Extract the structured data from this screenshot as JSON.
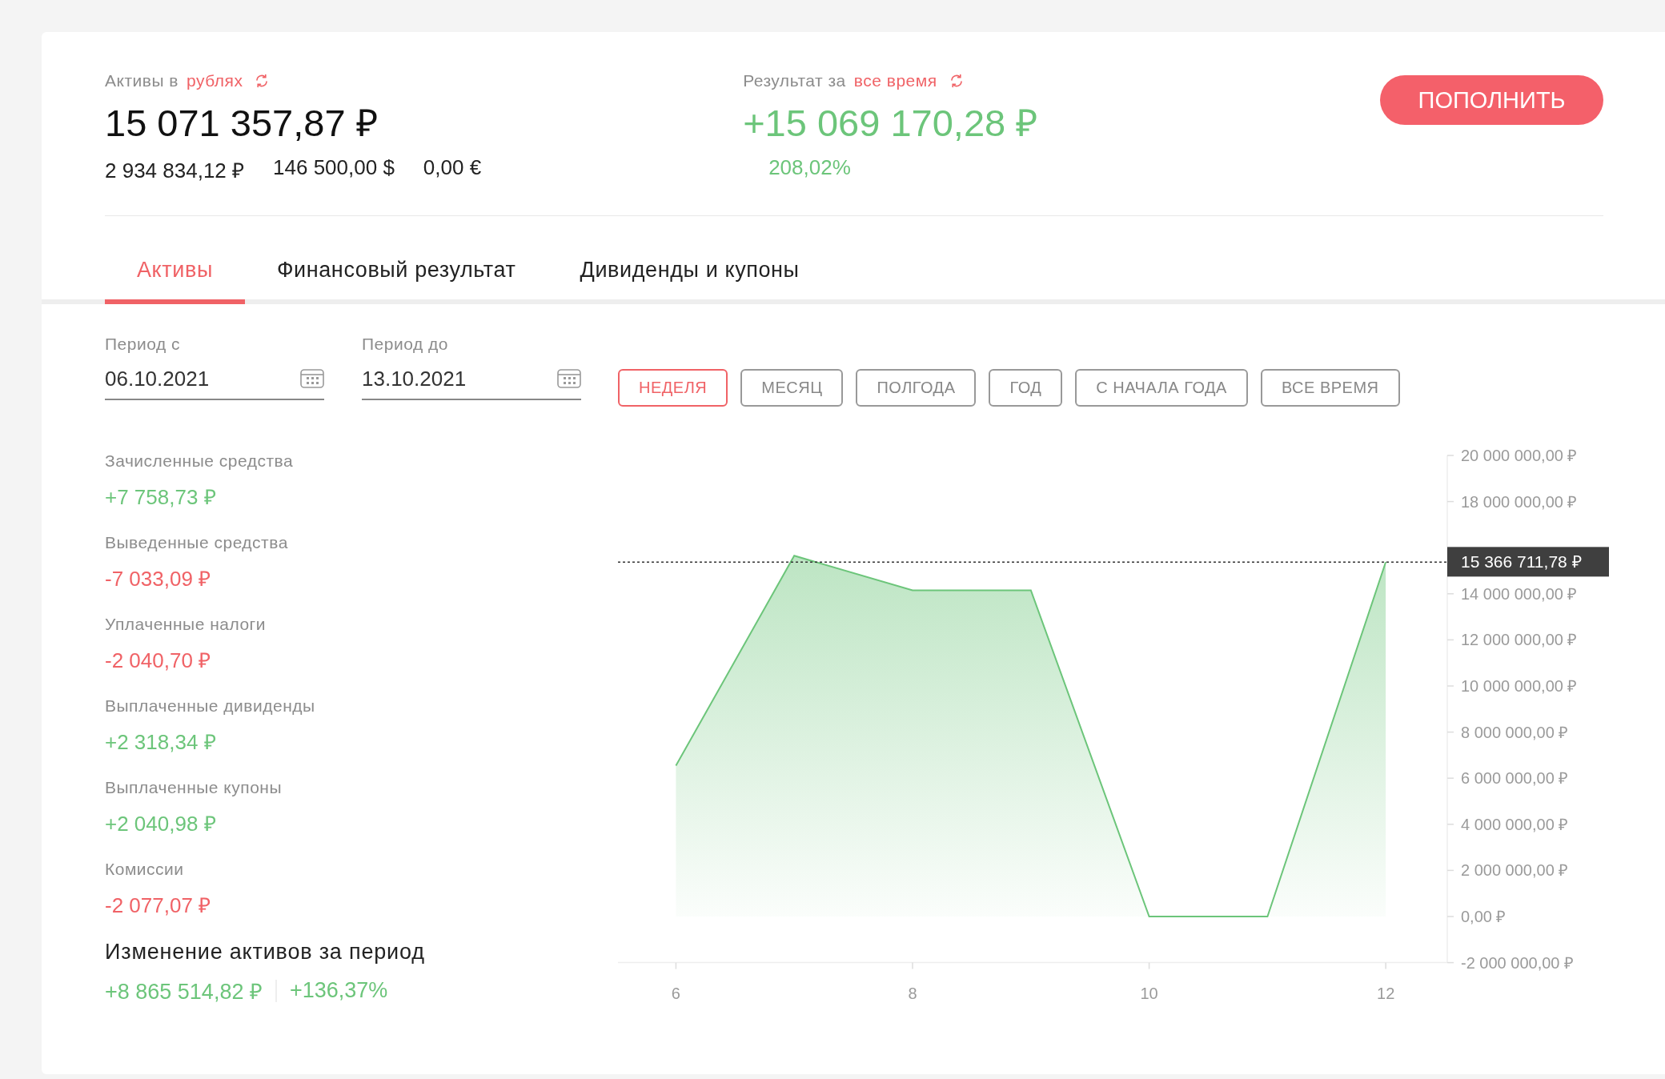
{
  "assets": {
    "label": "Активы в",
    "currency_link": "рублях",
    "total": "15 071 357,87 ₽",
    "breakdown": [
      "2 934 834,12 ₽",
      "146 500,00 $",
      "0,00 €"
    ]
  },
  "result": {
    "label": "Результат за",
    "period_link": "все время",
    "total": "+15 069 170,28 ₽",
    "percent": "208,02%"
  },
  "top_up_button": "ПОПОЛНИТЬ",
  "tabs": [
    {
      "label": "Активы",
      "selected": true
    },
    {
      "label": "Финансовый результат",
      "selected": false
    },
    {
      "label": "Дивиденды и купоны",
      "selected": false
    }
  ],
  "period": {
    "from": {
      "label": "Период с",
      "value": "06.10.2021"
    },
    "to": {
      "label": "Период до",
      "value": "13.10.2021"
    }
  },
  "period_buttons": [
    {
      "label": "НЕДЕЛЯ",
      "selected": true
    },
    {
      "label": "МЕСЯЦ",
      "selected": false
    },
    {
      "label": "ПОЛГОДА",
      "selected": false
    },
    {
      "label": "ГОД",
      "selected": false
    },
    {
      "label": "С НАЧАЛА ГОДА",
      "selected": false
    },
    {
      "label": "ВСЕ ВРЕМЯ",
      "selected": false
    }
  ],
  "stats": [
    {
      "label": "Зачисленные средства",
      "value": "+7 758,73 ₽",
      "color": "#6cc57a"
    },
    {
      "label": "Выведенные средства",
      "value": "-7 033,09 ₽",
      "color": "#f06266"
    },
    {
      "label": "Уплаченные налоги",
      "value": "-2 040,70 ₽",
      "color": "#f06266"
    },
    {
      "label": "Выплаченные дивиденды",
      "value": "+2 318,34 ₽",
      "color": "#6cc57a"
    },
    {
      "label": "Выплаченные купоны",
      "value": "+2 040,98 ₽",
      "color": "#6cc57a"
    },
    {
      "label": "Комиссии",
      "value": "-2 077,07 ₽",
      "color": "#f06266"
    }
  ],
  "change": {
    "title": "Изменение активов за период",
    "amount": "+8 865 514,82 ₽",
    "percent": "+136,37%"
  },
  "chart": {
    "chart_data": {
      "type": "area",
      "x": [
        6,
        7,
        8,
        9,
        10,
        11,
        12
      ],
      "series": [
        {
          "color": "#6cc57a",
          "values": [
            6540000,
            15650000,
            14150000,
            14150000,
            0,
            0,
            15370000
          ]
        }
      ],
      "xticks": [
        6,
        8,
        10,
        12
      ],
      "xlim": [
        5.51,
        12.52
      ],
      "ylim": [
        -2000000,
        20000000
      ],
      "yticks": [
        {
          "value": 20000000,
          "label": "20 000 000,00 ₽"
        },
        {
          "value": 18000000,
          "label": "18 000 000,00 ₽"
        },
        {
          "value": 14000000,
          "label": "14 000 000,00 ₽"
        },
        {
          "value": 12000000,
          "label": "12 000 000,00 ₽"
        },
        {
          "value": 10000000,
          "label": "10 000 000,00 ₽"
        },
        {
          "value": 8000000,
          "label": "8 000 000,00 ₽"
        },
        {
          "value": 6000000,
          "label": "6 000 000,00 ₽"
        },
        {
          "value": 4000000,
          "label": "4 000 000,00 ₽"
        },
        {
          "value": 2000000,
          "label": "2 000 000,00 ₽"
        },
        {
          "value": 0,
          "label": "0,00 ₽"
        },
        {
          "value": -2000000,
          "label": "-2 000 000,00 ₽"
        }
      ],
      "ref_lines": [
        {
          "axis": "y",
          "value": 15370000,
          "label": "15 366 711,78 ₽"
        }
      ]
    }
  }
}
